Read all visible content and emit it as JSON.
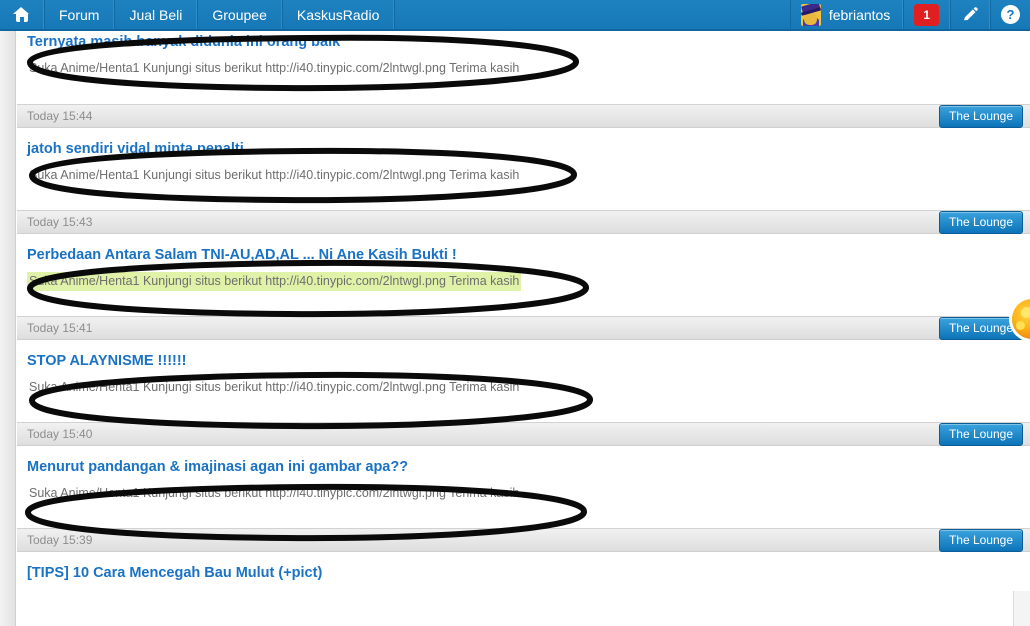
{
  "topnav": {
    "home_icon": "home-icon",
    "items": [
      {
        "label": "Forum"
      },
      {
        "label": "Jual Beli"
      },
      {
        "label": "Groupee"
      },
      {
        "label": "KaskusRadio"
      }
    ],
    "user": {
      "avatar_icon": "user-avatar",
      "name": "febriantos"
    },
    "notification_count": "1",
    "compose_icon": "pencil-icon",
    "help_icon": "help-icon",
    "bg_color": "#1678b6",
    "badge_color": "#e02020"
  },
  "feed": {
    "lounge_label": "The Lounge",
    "posts": [
      {
        "title": "Ternyata masih banyak didunia ini orang baik",
        "snippet": "Suka Anime/Henta1 Kunjungi situs berikut http://i40.tinypic.com/2lntwgl.png Terima kasih",
        "highlighted": false,
        "time": "Today 15:44"
      },
      {
        "title": "jatoh sendiri vidal minta penalti",
        "snippet": "Suka Anime/Henta1 Kunjungi situs berikut http://i40.tinypic.com/2lntwgl.png Terima kasih",
        "highlighted": false,
        "time": "Today 15:43"
      },
      {
        "title": "Perbedaan Antara Salam TNI-AU,AD,AL ... Ni Ane Kasih Bukti !",
        "snippet": "Suka Anime/Henta1 Kunjungi situs berikut http://i40.tinypic.com/2lntwgl.png Terima kasih",
        "highlighted": true,
        "time": "Today 15:41"
      },
      {
        "title": "STOP ALAYNISME !!!!!!",
        "snippet": "Suka Anime/Henta1 Kunjungi situs berikut http://i40.tinypic.com/2lntwgl.png Terima kasih",
        "highlighted": false,
        "time": "Today 15:40"
      },
      {
        "title": "Menurut pandangan & imajinasi agan ini gambar apa??",
        "snippet": "Suka Anime/Henta1 Kunjungi situs berikut http://i40.tinypic.com/2lntwgl.png Terima kasih",
        "highlighted": false,
        "time": "Today 15:39"
      },
      {
        "title": "[TIPS] 10 Cara Mencegah Bau Mulut (+pict)",
        "snippet": "",
        "highlighted": false,
        "time": ""
      }
    ],
    "title_color": "#1a72c4",
    "highlight_color": "#dff2a8"
  },
  "annotations": {
    "shape": "hand-drawn-ellipse",
    "color": "#000000",
    "count": 5
  },
  "edge_badge": {
    "icon": "orange-circle-badge",
    "color": "#ffb616"
  }
}
